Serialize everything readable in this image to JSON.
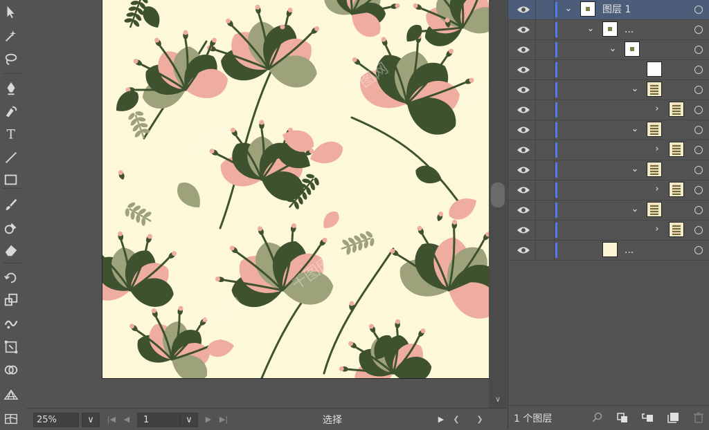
{
  "toolbar": {
    "tools": [
      {
        "name": "selection-tool",
        "icon": "arrow-icon"
      },
      {
        "name": "magic-wand-tool",
        "icon": "magic-wand-icon"
      },
      {
        "name": "lasso-tool",
        "icon": "lasso-icon"
      },
      {
        "name": "pen-tool",
        "icon": "pen-icon"
      },
      {
        "name": "curvature-tool",
        "icon": "curvature-pen-icon"
      },
      {
        "name": "type-tool",
        "icon": "type-icon",
        "glyph": "T"
      },
      {
        "name": "line-tool",
        "icon": "line-icon"
      },
      {
        "name": "rectangle-tool",
        "icon": "rectangle-icon"
      },
      {
        "name": "paintbrush-tool",
        "icon": "paintbrush-icon"
      },
      {
        "name": "shaper-tool",
        "icon": "shaper-icon"
      },
      {
        "name": "eraser-tool",
        "icon": "eraser-icon"
      },
      {
        "name": "rotate-tool",
        "icon": "rotate-icon"
      },
      {
        "name": "scale-tool",
        "icon": "scale-icon"
      },
      {
        "name": "warp-tool",
        "icon": "warp-icon"
      },
      {
        "name": "free-transform-tool",
        "icon": "free-transform-icon"
      },
      {
        "name": "shape-builder-tool",
        "icon": "shape-builder-icon"
      },
      {
        "name": "perspective-grid-tool",
        "icon": "perspective-grid-icon"
      },
      {
        "name": "mesh-tool",
        "icon": "mesh-icon"
      }
    ]
  },
  "status": {
    "zoom": "25%",
    "page": "1",
    "mode": "选择"
  },
  "layers": {
    "rows": [
      {
        "name": "图层 1",
        "level": 0,
        "chevron": "open",
        "thumb": "dot",
        "selected": true
      },
      {
        "name": "...",
        "level": 1,
        "chevron": "open",
        "thumb": "dot"
      },
      {
        "name": "",
        "level": 2,
        "chevron": "open",
        "thumb": "dot"
      },
      {
        "name": "",
        "level": 3,
        "chevron": "none",
        "thumb": "blank"
      },
      {
        "name": "",
        "level": 3,
        "chevron": "open",
        "thumb": "pattern"
      },
      {
        "name": "",
        "level": 4,
        "chevron": "closed",
        "thumb": "pattern"
      },
      {
        "name": "",
        "level": 3,
        "chevron": "open",
        "thumb": "pattern"
      },
      {
        "name": "",
        "level": 4,
        "chevron": "closed",
        "thumb": "pattern"
      },
      {
        "name": "",
        "level": 3,
        "chevron": "open",
        "thumb": "pattern"
      },
      {
        "name": "",
        "level": 4,
        "chevron": "closed",
        "thumb": "pattern"
      },
      {
        "name": "",
        "level": 3,
        "chevron": "open",
        "thumb": "pattern"
      },
      {
        "name": "",
        "level": 4,
        "chevron": "closed",
        "thumb": "pattern"
      },
      {
        "name": "...",
        "level": 1,
        "chevron": "none",
        "thumb": "cream"
      }
    ],
    "count_label": "1 个图层"
  },
  "colors": {
    "artboard_bg": "#fdf8d8",
    "dark_green": "#3f5230",
    "sage_green": "#9da27a",
    "pink": "#efada0",
    "selection_blue": "#4f7bef"
  },
  "watermark": "千图网"
}
